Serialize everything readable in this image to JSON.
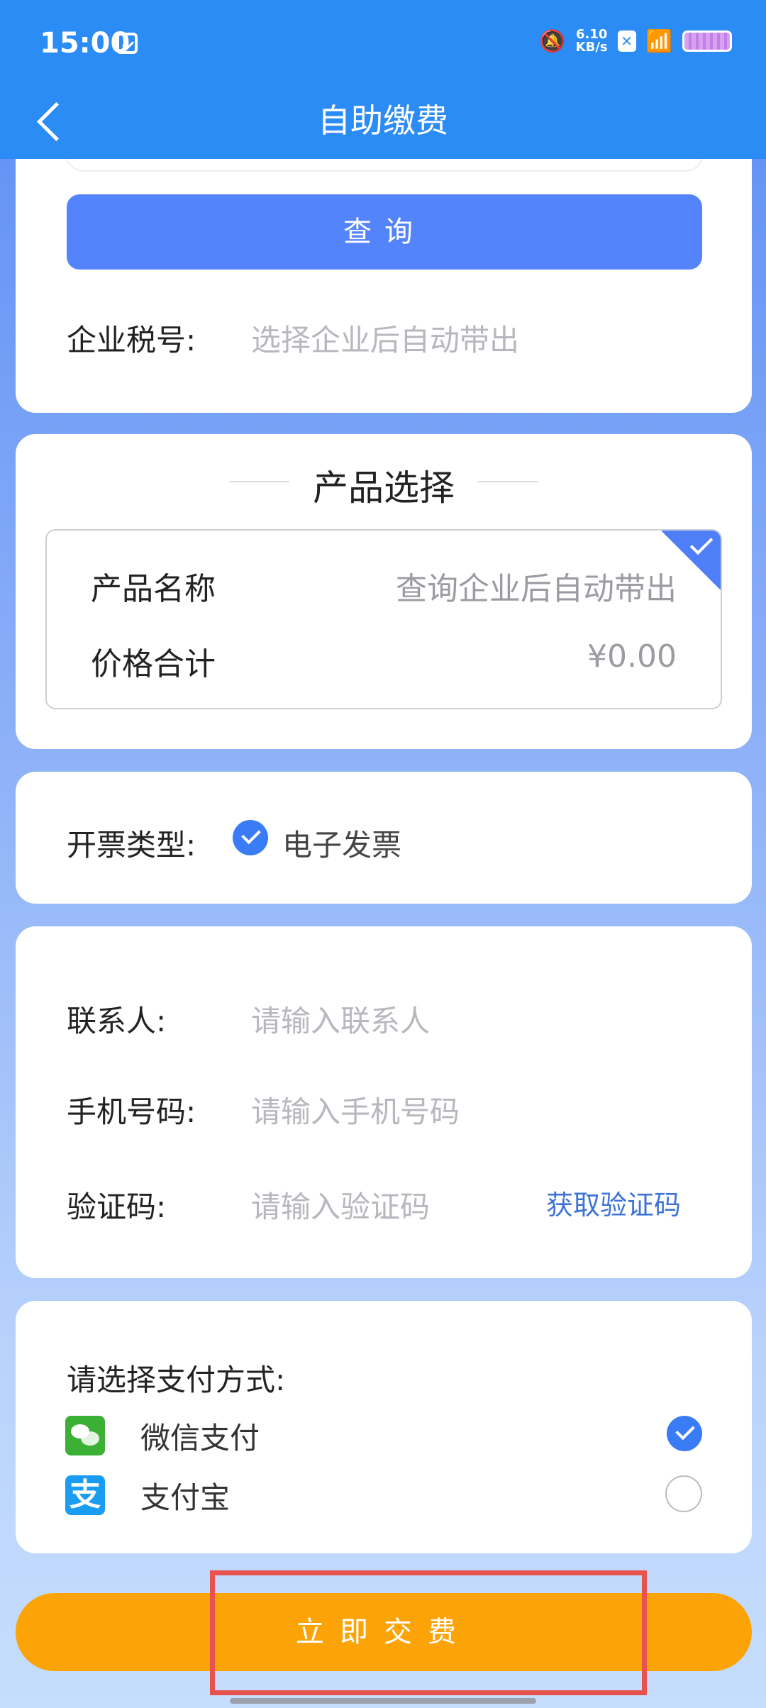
{
  "status_bar": {
    "time": "15:00",
    "net_speed_value": "6.10",
    "net_speed_unit": "KB/s",
    "icons": [
      "calendar-icon",
      "bell-mute-icon",
      "x-box-icon",
      "wifi-icon",
      "battery-icon"
    ]
  },
  "nav": {
    "title": "自助缴费"
  },
  "company": {
    "query_label": "查询",
    "tax_label": "企业税号:",
    "tax_placeholder": "选择企业后自动带出"
  },
  "product": {
    "section_title": "产品选择",
    "name_label": "产品名称",
    "name_value": "查询企业后自动带出",
    "price_label": "价格合计",
    "price_value": "¥0.00"
  },
  "invoice": {
    "label": "开票类型:",
    "option": "电子发票",
    "selected": true
  },
  "contact": {
    "name_label": "联系人:",
    "name_placeholder": "请输入联系人",
    "phone_label": "手机号码:",
    "phone_placeholder": "请输入手机号码",
    "code_label": "验证码:",
    "code_placeholder": "请输入验证码",
    "get_code": "获取验证码"
  },
  "payment": {
    "title": "请选择支付方式:",
    "methods": [
      {
        "label": "微信支付",
        "icon": "wechat-pay-icon",
        "selected": true
      },
      {
        "label": "支付宝",
        "icon": "alipay-icon",
        "selected": false
      }
    ],
    "alipay_glyph": "支"
  },
  "submit": {
    "label": "立即交费"
  },
  "colors": {
    "topbar": "#2b8cf5",
    "accent": "#5484fb",
    "submit": "#fba307",
    "highlight": "#e85350"
  }
}
